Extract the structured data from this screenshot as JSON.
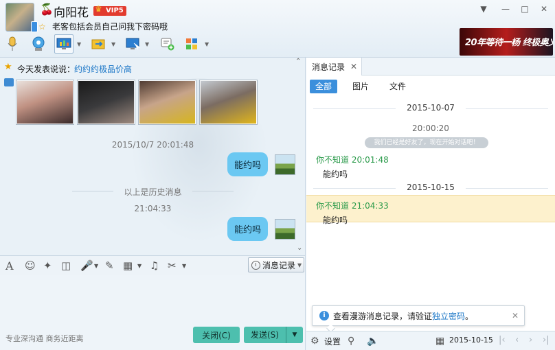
{
  "header": {
    "contact_name": "向阳花",
    "vip_label": "VIP5",
    "signature": "老客包括会员自己问我下密码哦",
    "ad_text": "20年等待一杨 终极奥义",
    "toolbar_icons": [
      "microphone-icon",
      "video-icon",
      "screen-share-icon",
      "transfer-file-icon",
      "remote-desktop-icon",
      "add-note-icon",
      "apps-icon"
    ]
  },
  "chat": {
    "mood_label": "今天发表说说：",
    "mood_link": "约约约极品价高",
    "messages": [
      {
        "time": "2015/10/7 20:01:48",
        "text": "能约吗"
      },
      {
        "time": "21:04:33",
        "text": "能约吗"
      }
    ],
    "history_divider": "以上是历史消息"
  },
  "input": {
    "history_button": "消息记录",
    "slogan": "专业深沟通 商务近距离",
    "close_label": "关闭(C)",
    "send_label": "发送(S)"
  },
  "history_panel": {
    "tab_label": "消息记录",
    "filters": [
      "全部",
      "图片",
      "文件"
    ],
    "date1": "2015-10-07",
    "time1": "20:00:20",
    "system_msg": "我们已经是好友了，现在开始对话吧！",
    "msg1": {
      "sender": "你不知道 20:01:48",
      "text": "能约吗"
    },
    "date2": "2015-10-15",
    "msg2": {
      "sender": "你不知道 21:04:33",
      "text": "能约吗"
    },
    "tip_text": "查看漫游消息记录，请验证",
    "tip_link": "独立密码",
    "tip_end": "。",
    "settings_label": "设置",
    "current_date": "2015-10-15"
  },
  "colors": {
    "bubble": "#6bc8f2",
    "accent_button": "#4dbfae",
    "link": "#1774c6",
    "filter_active": "#3b8fdc",
    "highlight_row": "#fdf1cd"
  }
}
